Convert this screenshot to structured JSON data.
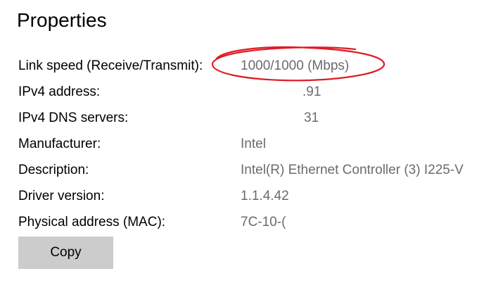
{
  "header": {
    "title": "Properties"
  },
  "properties": [
    {
      "label": "Link speed (Receive/Transmit):",
      "value": "1000/1000 (Mbps)"
    },
    {
      "label": "IPv4 address:",
      "value": ".91"
    },
    {
      "label": "IPv4 DNS servers:",
      "value": "31"
    },
    {
      "label": "Manufacturer:",
      "value": "Intel"
    },
    {
      "label": "Description:",
      "value": "Intel(R) Ethernet Controller (3) I225-V"
    },
    {
      "label": "Driver version:",
      "value": "1.1.4.42"
    },
    {
      "label": "Physical address (MAC):",
      "value": "7C-10-("
    }
  ],
  "actions": {
    "copy_label": "Copy"
  },
  "colors": {
    "value_text": "#6b6b6b",
    "button_bg": "#cccccc",
    "annotation": "#e01b24"
  }
}
